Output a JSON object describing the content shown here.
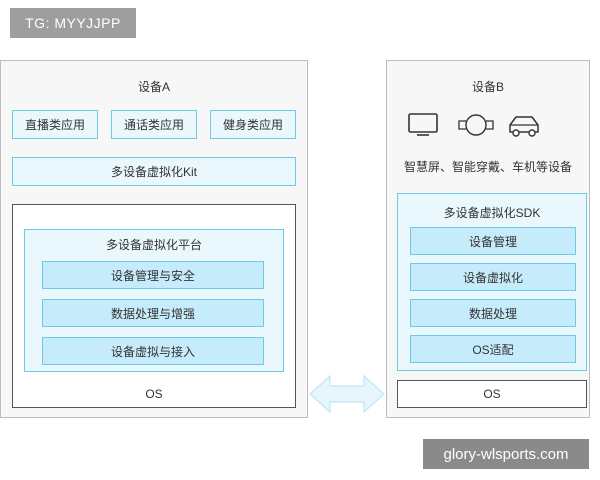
{
  "tag": "TG: MYYJJPP",
  "watermark": "glory-wlsports.com",
  "device_a": {
    "title": "设备A",
    "apps": [
      "直播类应用",
      "通话类应用",
      "健身类应用"
    ],
    "kit": "多设备虚拟化Kit",
    "platform": {
      "title": "多设备虚拟化平台",
      "modules": [
        "设备管理与安全",
        "数据处理与增强",
        "设备虚拟与接入"
      ]
    },
    "os": "OS"
  },
  "device_b": {
    "title": "设备B",
    "icons": [
      "tv-icon",
      "watch-icon",
      "car-icon"
    ],
    "caption": "智慧屏、智能穿戴、车机等设备",
    "sdk": {
      "title": "多设备虚拟化SDK",
      "modules": [
        "设备管理",
        "设备虚拟化",
        "数据处理",
        "OS适配"
      ]
    },
    "os": "OS"
  },
  "colors": {
    "light_box": "#eaf7fd",
    "blue_box": "#c6ebfa",
    "border_blue": "#6ecbe8",
    "panel": "#f7f7f7",
    "arrow_fill": "#e6f6fc"
  }
}
